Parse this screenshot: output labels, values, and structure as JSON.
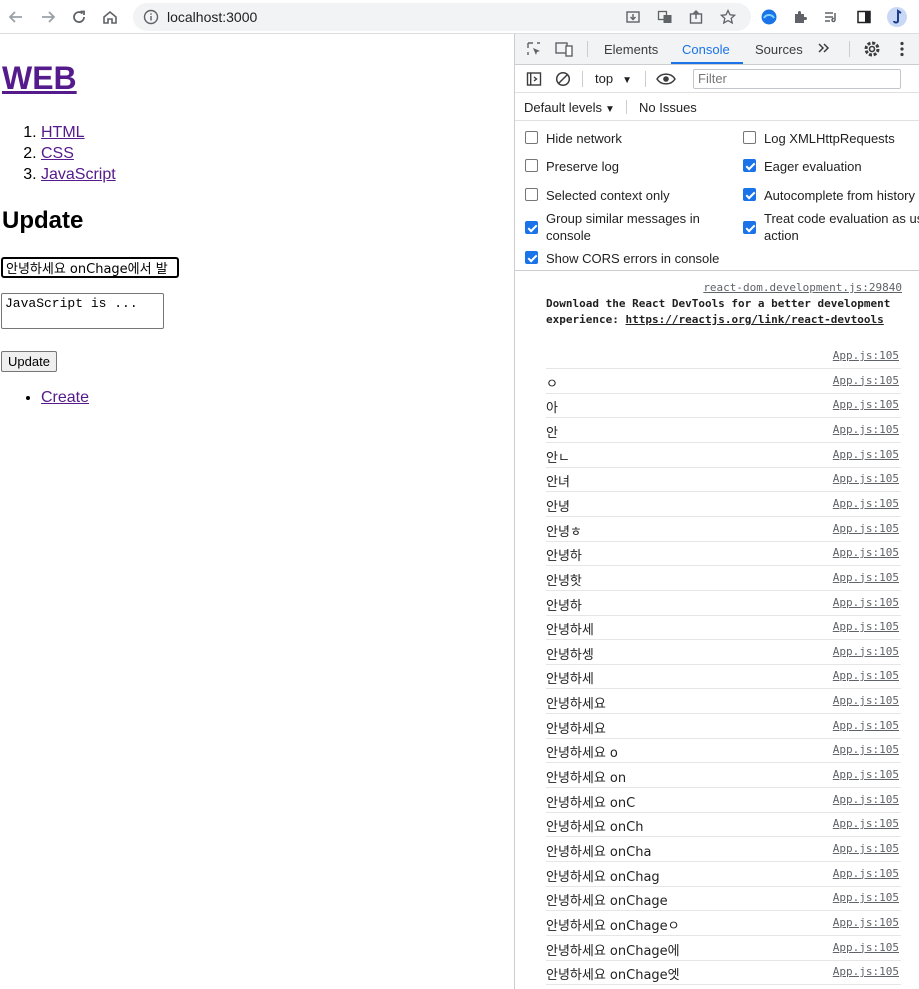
{
  "browser": {
    "url": "localhost:3000"
  },
  "page": {
    "title": "WEB",
    "nav": [
      "HTML",
      "CSS",
      "JavaScript"
    ],
    "heading": "Update",
    "title_input_value": "안녕하세요 onChage에서 발",
    "body_textarea_value": "JavaScript is ...",
    "update_button": "Update",
    "create_link": "Create"
  },
  "devtools": {
    "tabs": [
      "Elements",
      "Console",
      "Sources"
    ],
    "context": "top",
    "filter_placeholder": "Filter",
    "levels": "Default levels",
    "issues": "No Issues",
    "settings": {
      "hide_network": {
        "label": "Hide network",
        "checked": false
      },
      "log_xhr": {
        "label": "Log XMLHttpRequests",
        "checked": false
      },
      "preserve_log": {
        "label": "Preserve log",
        "checked": false
      },
      "eager_eval": {
        "label": "Eager evaluation",
        "checked": true
      },
      "selected_context": {
        "label": "Selected context only",
        "checked": false
      },
      "autocomplete": {
        "label": "Autocomplete from history",
        "checked": true
      },
      "group_similar": {
        "label": "Group similar messages in console",
        "checked": true
      },
      "treat_code": {
        "label": "Treat code evaluation as user action",
        "checked": true
      },
      "show_cors": {
        "label": "Show CORS errors in console",
        "checked": true
      }
    },
    "devtools_message": {
      "source": "react-dom.development.js:29840",
      "text": "Download the React DevTools for a better development experience: ",
      "link": "https://reactjs.org/link/react-devtools"
    },
    "log_source": "App.js:105",
    "logs": [
      "",
      "ㅇ",
      "아",
      "안",
      "안ㄴ",
      "안녀",
      "안녕",
      "안녕ㅎ",
      "안녕하",
      "안녕핫",
      "안녕하",
      "안녕하세",
      "안녕하셍",
      "안녕하세",
      "안녕하세요",
      "안녕하세요",
      "안녕하세요 o",
      "안녕하세요 on",
      "안녕하세요 onC",
      "안녕하세요 onCh",
      "안녕하세요 onCha",
      "안녕하세요 onChag",
      "안녕하세요 onChage",
      "안녕하세요 onChageㅇ",
      "안녕하세요 onChage에",
      "안녕하세요 onChage엣"
    ]
  }
}
